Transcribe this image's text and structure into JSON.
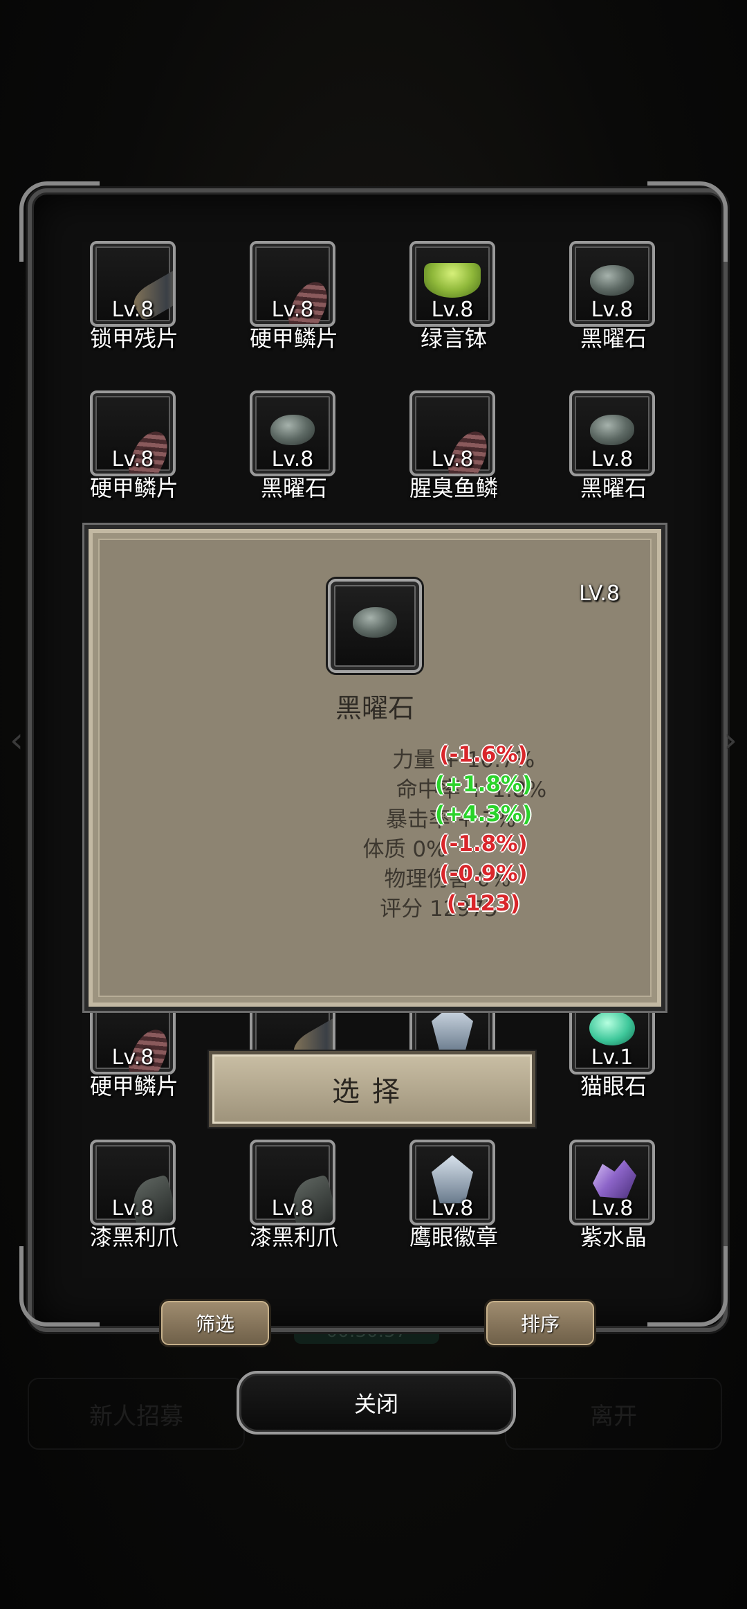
{
  "background": {
    "btn_left": "新人招募",
    "btn_right": "离开",
    "timer": "00:30:57"
  },
  "grid_items": [
    {
      "name": "锁甲残片",
      "level": "Lv.8",
      "icon": "fragment-icon"
    },
    {
      "name": "硬甲鳞片",
      "level": "Lv.8",
      "icon": "scale-icon"
    },
    {
      "name": "绿言钵",
      "level": "Lv.8",
      "icon": "bowl-icon"
    },
    {
      "name": "黑曜石",
      "level": "Lv.8",
      "icon": "stone-icon"
    },
    {
      "name": "硬甲鳞片",
      "level": "Lv.8",
      "icon": "scale-icon"
    },
    {
      "name": "黑曜石",
      "level": "Lv.8",
      "icon": "stone-icon"
    },
    {
      "name": "腥臭鱼鳞",
      "level": "Lv.8",
      "icon": "scale-icon"
    },
    {
      "name": "黑曜石",
      "level": "Lv.8",
      "icon": "stone-icon"
    },
    {
      "name": "硬甲鳞片",
      "level": "Lv.8",
      "icon": "scale-icon"
    },
    {
      "name": "猫眼石",
      "level": "Lv.1",
      "icon": "catseye-icon"
    },
    {
      "name": "漆黑利爪",
      "level": "Lv.8",
      "icon": "claw-icon"
    },
    {
      "name": "漆黑利爪",
      "level": "Lv.8",
      "icon": "claw-icon"
    },
    {
      "name": "鹰眼徽章",
      "level": "Lv.8",
      "icon": "badge-icon"
    },
    {
      "name": "紫水晶",
      "level": "Lv.8",
      "icon": "crystal-icon"
    }
  ],
  "detail": {
    "level": "LV.8",
    "name": "黑曜石",
    "stats": [
      {
        "label": "力量 + 10.7%",
        "delta": "(-1.6%)",
        "color": "#d9262b"
      },
      {
        "label": "命中率 + 1.8%",
        "delta": "(+1.8%)",
        "color": "#2ad32a"
      },
      {
        "label": "暴击率 + 7%",
        "delta": "(+4.3%)",
        "color": "#2ad32a"
      },
      {
        "label": "体质  0%",
        "delta": "(-1.8%)",
        "color": "#d9262b"
      },
      {
        "label": "物理伤害 0%",
        "delta": "(-0.9%)",
        "color": "#d9262b"
      },
      {
        "label": "评分 12975",
        "delta": "(-123)",
        "color": "#d9262b"
      }
    ]
  },
  "buttons": {
    "select": "选择",
    "filter": "筛选",
    "sort": "排序",
    "close": "关闭"
  }
}
